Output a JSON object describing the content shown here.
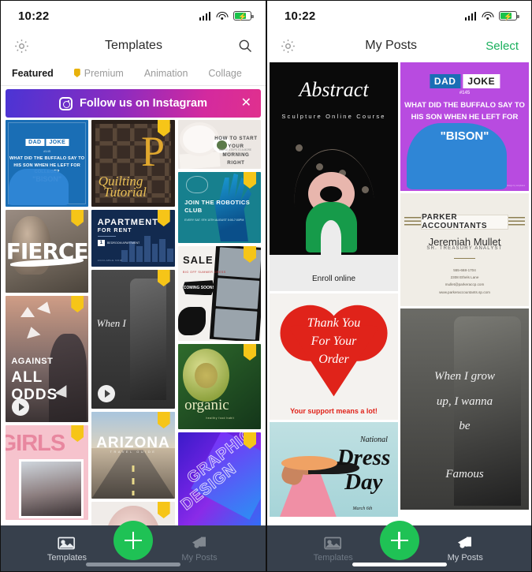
{
  "left": {
    "status": {
      "time": "10:22",
      "signal_icon": "cellular-signal-icon",
      "wifi_icon": "wifi-icon",
      "battery_icon": "battery-charging-icon"
    },
    "nav": {
      "settings_icon": "gear-icon",
      "title": "Templates",
      "search_icon": "search-icon"
    },
    "tabs": [
      {
        "label": "Featured",
        "active": true,
        "premium": false
      },
      {
        "label": "Premium",
        "active": false,
        "premium": true
      },
      {
        "label": "Animation",
        "active": false,
        "premium": false
      },
      {
        "label": "Collage",
        "active": false,
        "premium": false
      }
    ],
    "banner": {
      "icon": "instagram-icon",
      "text": "Follow us on Instagram",
      "close_icon": "close-icon"
    },
    "templates": {
      "dadjoke": {
        "tag1": "DAD",
        "tag2": "JOKE",
        "number": "#145",
        "question": "WHAT DID THE BUFFALO SAY TO HIS SON WHEN HE LEFT FOR COLLEGE?",
        "answer": "\"BISON\""
      },
      "quilting": {
        "letter": "P",
        "line1": "Quilting",
        "line2": "Tutorial"
      },
      "morning": {
        "title": "HOW TO START YOUR MORNING RIGHT",
        "sub": "SIMPLE STEPS TO A MORE PRODUCTIVE DAY"
      },
      "robotics": {
        "title": "JOIN THE ROBOTICS CLUB",
        "sub": "EVERY SAT. 9TH 10TH AUGUST 5:00-7:00PM"
      },
      "fierce": {
        "word": "FIERCE"
      },
      "apartment": {
        "t1": "APARTMENT",
        "t2": "FOR RENT",
        "badge": "1",
        "badge_text": "BEDROOM APARTMENT",
        "avail": "AVAILABLE NOW"
      },
      "wheni": {
        "text": "When I"
      },
      "sale": {
        "t": "SALE",
        "s": "BIG OFF SUMMER DRESS",
        "burst": "COMING SOON!"
      },
      "odds": {
        "t1": "AGAINST",
        "t2": "ALL",
        "t3": "ODDS"
      },
      "organic": {
        "t": "organic",
        "s": "healthy food habit"
      },
      "arizona": {
        "t": "ARIZONA",
        "s": "TRAVEL GUIDE"
      },
      "girls": {
        "t": "GIRLS"
      },
      "graphic": {
        "t": "GRAPHIC",
        "t2": "DESIGN"
      }
    }
  },
  "right": {
    "status": {
      "time": "10:22",
      "signal_icon": "cellular-signal-icon",
      "wifi_icon": "wifi-icon",
      "battery_icon": "battery-charging-icon"
    },
    "nav": {
      "settings_icon": "gear-icon",
      "title": "My Posts",
      "select_label": "Select"
    },
    "posts": {
      "abstract": {
        "title": "Abstract",
        "subtitle": "Sculpture Online Course",
        "cta": "Enroll online"
      },
      "dadjoke": {
        "tag1": "DAD",
        "tag2": "JOKE",
        "number": "#145",
        "question": "WHAT DID THE BUFFALO SAY TO HIS SON WHEN HE LEFT FOR COLLEGE?",
        "answer": "\"BISON\"",
        "credit": "design by templates"
      },
      "business_card": {
        "company": "PARKER ACCOUNTANTS",
        "name": "Jeremiah Mullet",
        "role": "SR. TREASURY ANALYST",
        "phone": "555-668-1704",
        "address": "2308 Ethels Lane",
        "email": "mullet@parkeraccp.com",
        "website": "www.parkeraccountants.sp.com"
      },
      "thank_you": {
        "line1": "Thank You",
        "line2": "For Your",
        "line3": "Order",
        "sub": "Your support means a lot!"
      },
      "dress_day": {
        "t1": "National",
        "t2": "Dress",
        "t3": "Day",
        "t4": "March 6th"
      },
      "when_i_grow": {
        "line1": "When I grow",
        "line2": "up, I wanna",
        "line3": "be",
        "line4": "Famous"
      }
    }
  },
  "tabbar": {
    "templates_label": "Templates",
    "templates_icon": "photo-gallery-icon",
    "create_icon": "plus-icon",
    "myposts_label": "My Posts",
    "myposts_icon": "megaphone-icon"
  },
  "colors": {
    "accent_green": "#1fc255",
    "select_green": "#1aaf5c",
    "tabbar_bg": "#37404c",
    "premium_gold": "#e8b20c",
    "instagram_gradient_start": "#4b34d4",
    "instagram_gradient_end": "#e0308e"
  }
}
